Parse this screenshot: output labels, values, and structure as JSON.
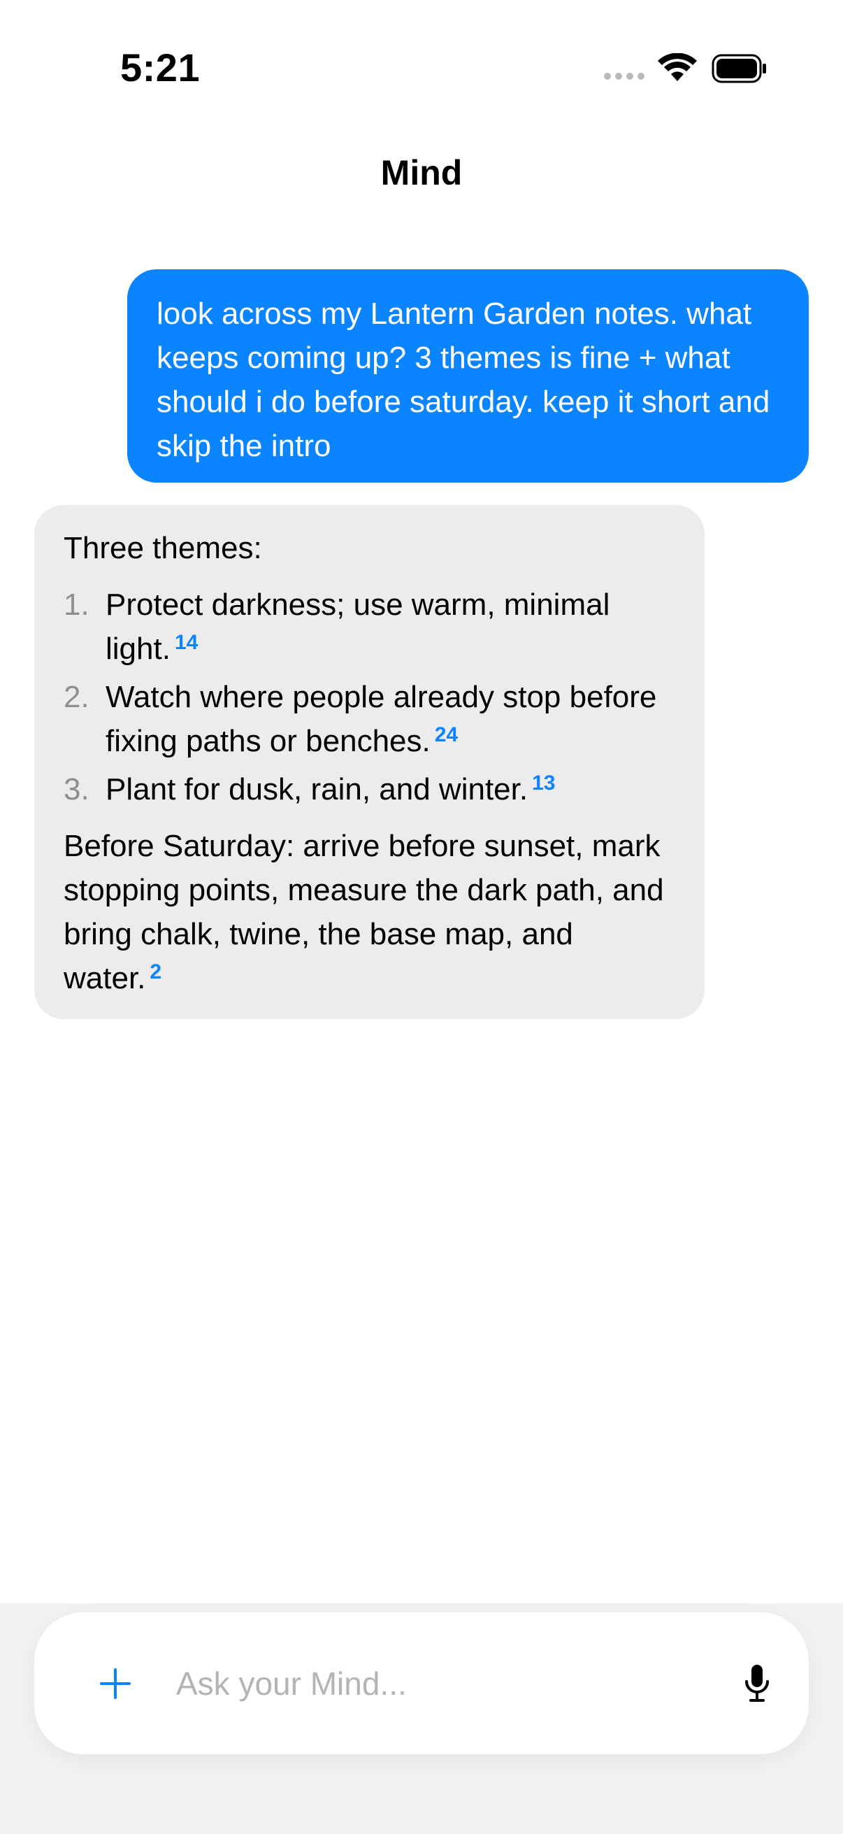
{
  "status_bar": {
    "time": "5:21"
  },
  "header": {
    "title": "Mind"
  },
  "conversation": {
    "user_message": "look across my Lantern Garden notes. what keeps coming up? 3 themes is fine + what should i do before saturday. keep it short and skip the intro",
    "assistant": {
      "heading": "Three themes:",
      "themes": [
        {
          "number": "1.",
          "text": "Protect darkness; use warm, minimal light.",
          "citation": "14"
        },
        {
          "number": "2.",
          "text": "Watch where people already stop before fixing paths or benches.",
          "citation": "24"
        },
        {
          "number": "3.",
          "text": "Plant for dusk, rain, and winter.",
          "citation": "13"
        }
      ],
      "saturday": {
        "text": "Before Saturday: arrive before sunset, mark stopping points, measure the dark path, and bring chalk, twine, the base map, and water.",
        "citation": "2"
      }
    }
  },
  "input_bar": {
    "placeholder": "Ask your Mind...",
    "value": ""
  },
  "colors": {
    "accent": "#0a84ff",
    "assistant_bubble": "#ececec",
    "input_area": "#f2f2f2"
  },
  "icons": {
    "wifi": "wifi-icon",
    "battery": "battery-icon",
    "add": "plus-icon",
    "mic": "microphone-icon"
  }
}
